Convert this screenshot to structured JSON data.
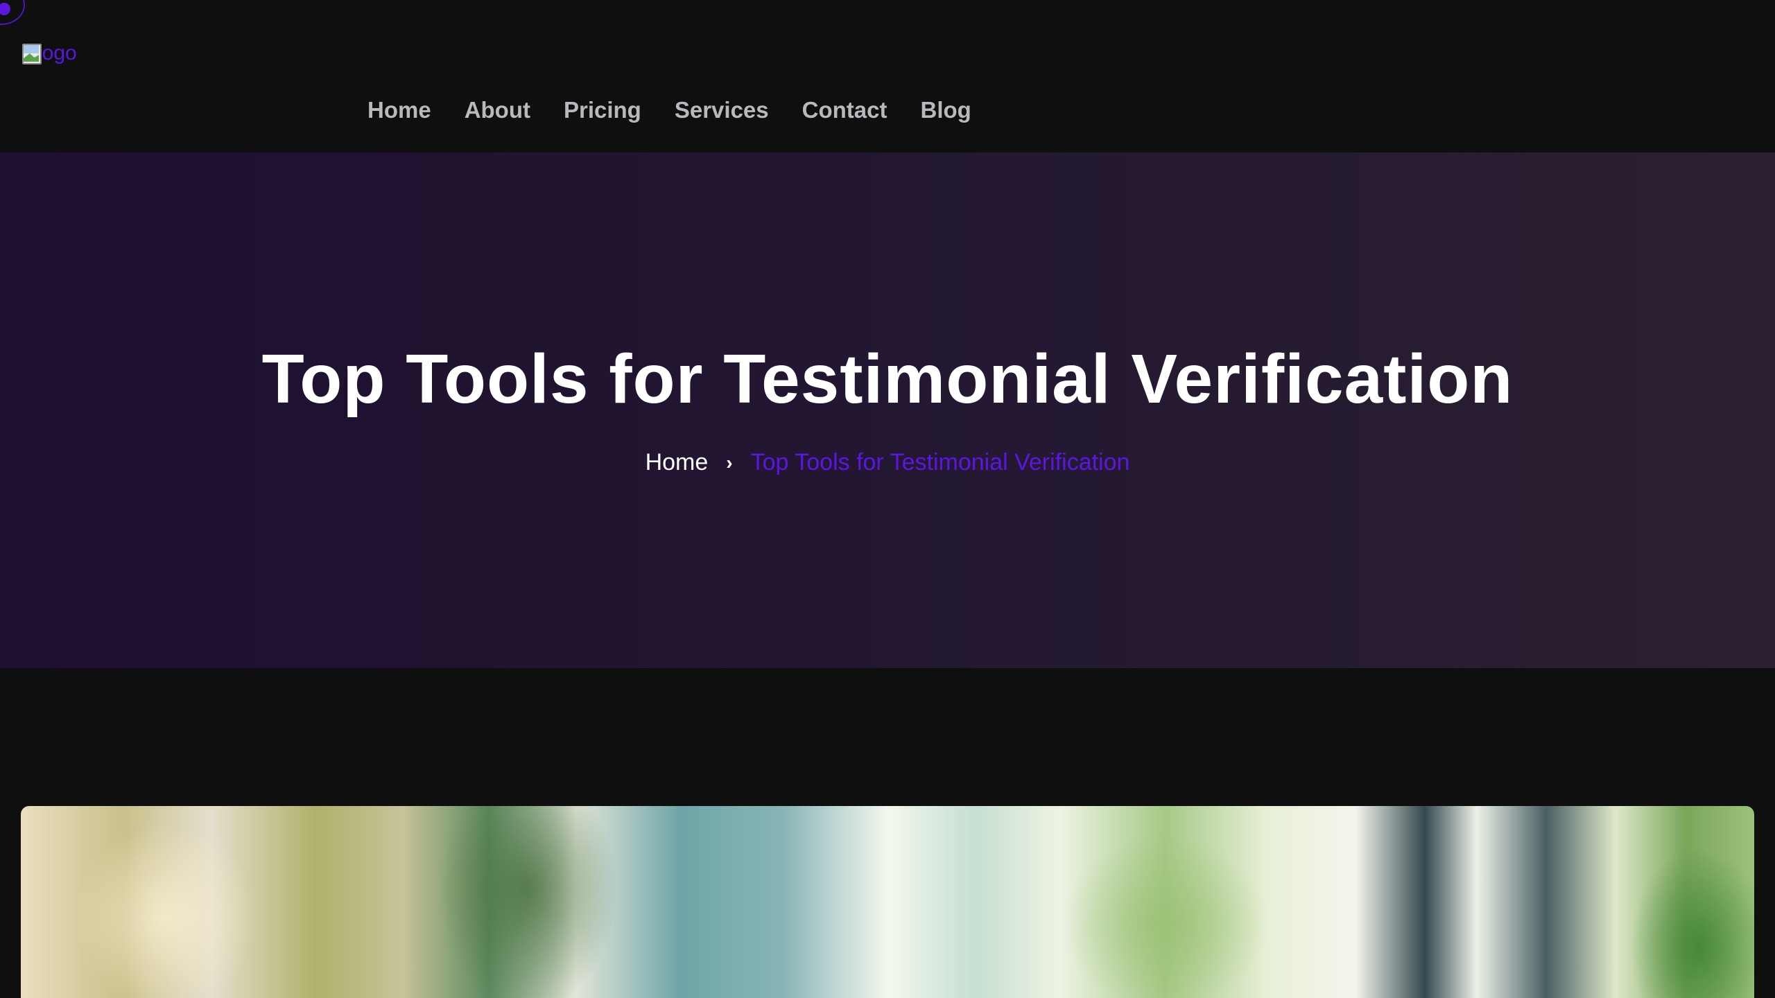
{
  "header": {
    "logo_alt": "logo",
    "nav": [
      "Home",
      "About",
      "Pricing",
      "Services",
      "Contact",
      "Blog"
    ]
  },
  "hero": {
    "title": "Top Tools for Testimonial Verification",
    "breadcrumb": {
      "home": "Home",
      "current": "Top Tools for Testimonial Verification"
    }
  },
  "colors": {
    "accent": "#5b17e0",
    "background": "#0f0f10",
    "hero_start": "#1d0f2e",
    "hero_end": "#2a2030"
  },
  "icons": {
    "breadcrumb_separator": "chevron-right-icon",
    "logo": "broken-image-icon"
  }
}
